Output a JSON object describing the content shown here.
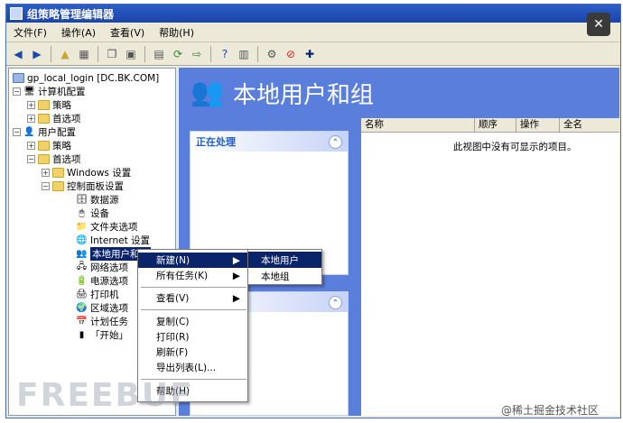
{
  "window": {
    "title": "组策略管理编辑器"
  },
  "menubar": [
    {
      "label": "文件(F)"
    },
    {
      "label": "操作(A)"
    },
    {
      "label": "查看(V)"
    },
    {
      "label": "帮助(H)"
    }
  ],
  "tree": {
    "items": [
      {
        "label": "gp_local_login [DC.BK.COM]"
      },
      {
        "label": "计算机配置"
      },
      {
        "label": "策略"
      },
      {
        "label": "首选项"
      },
      {
        "label": "用户配置"
      },
      {
        "label": "策略"
      },
      {
        "label": "首选项"
      },
      {
        "label": "Windows 设置"
      },
      {
        "label": "控制面板设置"
      },
      {
        "label": "数据源"
      },
      {
        "label": "设备"
      },
      {
        "label": "文件夹选项"
      },
      {
        "label": "Internet 设置"
      },
      {
        "label": "本地用户和组"
      },
      {
        "label": "网络选项"
      },
      {
        "label": "电源选项"
      },
      {
        "label": "打印机"
      },
      {
        "label": "区域选项"
      },
      {
        "label": "计划任务"
      },
      {
        "label": "「开始」"
      }
    ]
  },
  "main": {
    "title": "本地用户和组",
    "task_panel_title": "正在处理",
    "columns": [
      "名称",
      "顺序",
      "操作",
      "全名"
    ],
    "empty_text": "此视图中没有可显示的项目。"
  },
  "context_menu": {
    "items": [
      "新建(N)",
      "所有任务(K)",
      "查看(V)",
      "复制(C)",
      "打印(R)",
      "刷新(F)",
      "导出列表(L)...",
      "帮助(H)"
    ]
  },
  "submenu": {
    "items": [
      "本地用户",
      "本地组"
    ]
  },
  "watermark": {
    "left": "FREEBUF",
    "right": "@稀土掘金技术社区"
  }
}
